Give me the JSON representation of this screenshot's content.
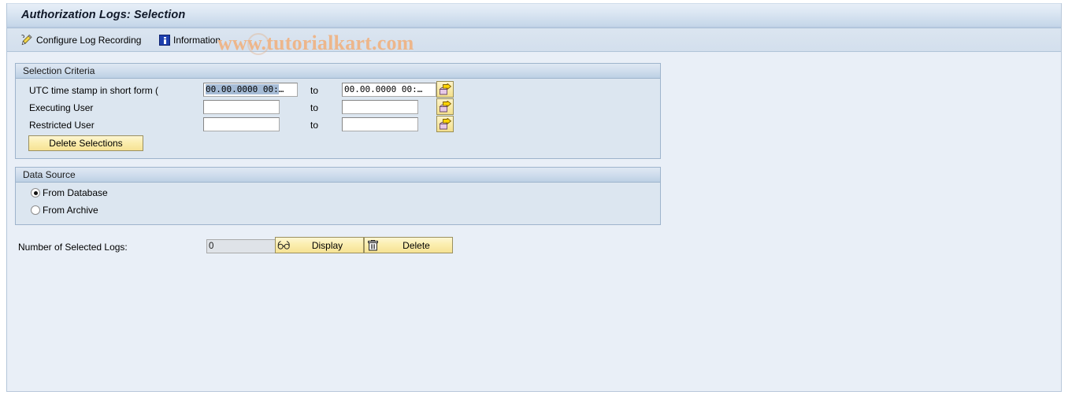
{
  "window": {
    "title": "Authorization Logs: Selection"
  },
  "toolbar": {
    "items": [
      {
        "label": "Configure Log Recording",
        "icon": "pencil-icon"
      },
      {
        "label": "Information",
        "icon": "information-icon"
      }
    ]
  },
  "watermark": {
    "text": "www.tutorialkart.com",
    "color": "#edb68b"
  },
  "selection_criteria": {
    "header": "Selection Criteria",
    "rows": [
      {
        "label": "UTC time stamp in short form (",
        "from_value": "00.00.0000  00:",
        "from_ellipsis": "…",
        "from_selected": true,
        "to_label": "to",
        "to_value": "00.00.0000  00:",
        "to_ellipsis": "…",
        "multi_select_icon": "multiple-selection-arrow-icon"
      },
      {
        "label": "Executing User",
        "from_value": "",
        "from_ellipsis": "",
        "from_selected": false,
        "to_label": "to",
        "to_value": "",
        "to_ellipsis": "",
        "multi_select_icon": "multiple-selection-arrow-icon"
      },
      {
        "label": "Restricted User",
        "from_value": "",
        "from_ellipsis": "",
        "from_selected": false,
        "to_label": "to",
        "to_value": "",
        "to_ellipsis": "",
        "multi_select_icon": "multiple-selection-arrow-icon"
      }
    ],
    "delete_selections_label": "Delete Selections"
  },
  "data_source": {
    "header": "Data Source",
    "options": [
      {
        "label": "From Database",
        "selected": true
      },
      {
        "label": "From Archive",
        "selected": false
      }
    ]
  },
  "footer": {
    "count_label": "Number of Selected Logs:",
    "count_value": "0",
    "display_label": "Display",
    "display_icon": "eyeglasses-icon",
    "delete_label": "Delete",
    "delete_icon": "trash-icon"
  },
  "colors": {
    "accent_yellow": "#f6e294",
    "group_bg": "#dce6f0",
    "canvas_bg": "#e9eff7",
    "titlebar_bg": "#cedcec"
  }
}
